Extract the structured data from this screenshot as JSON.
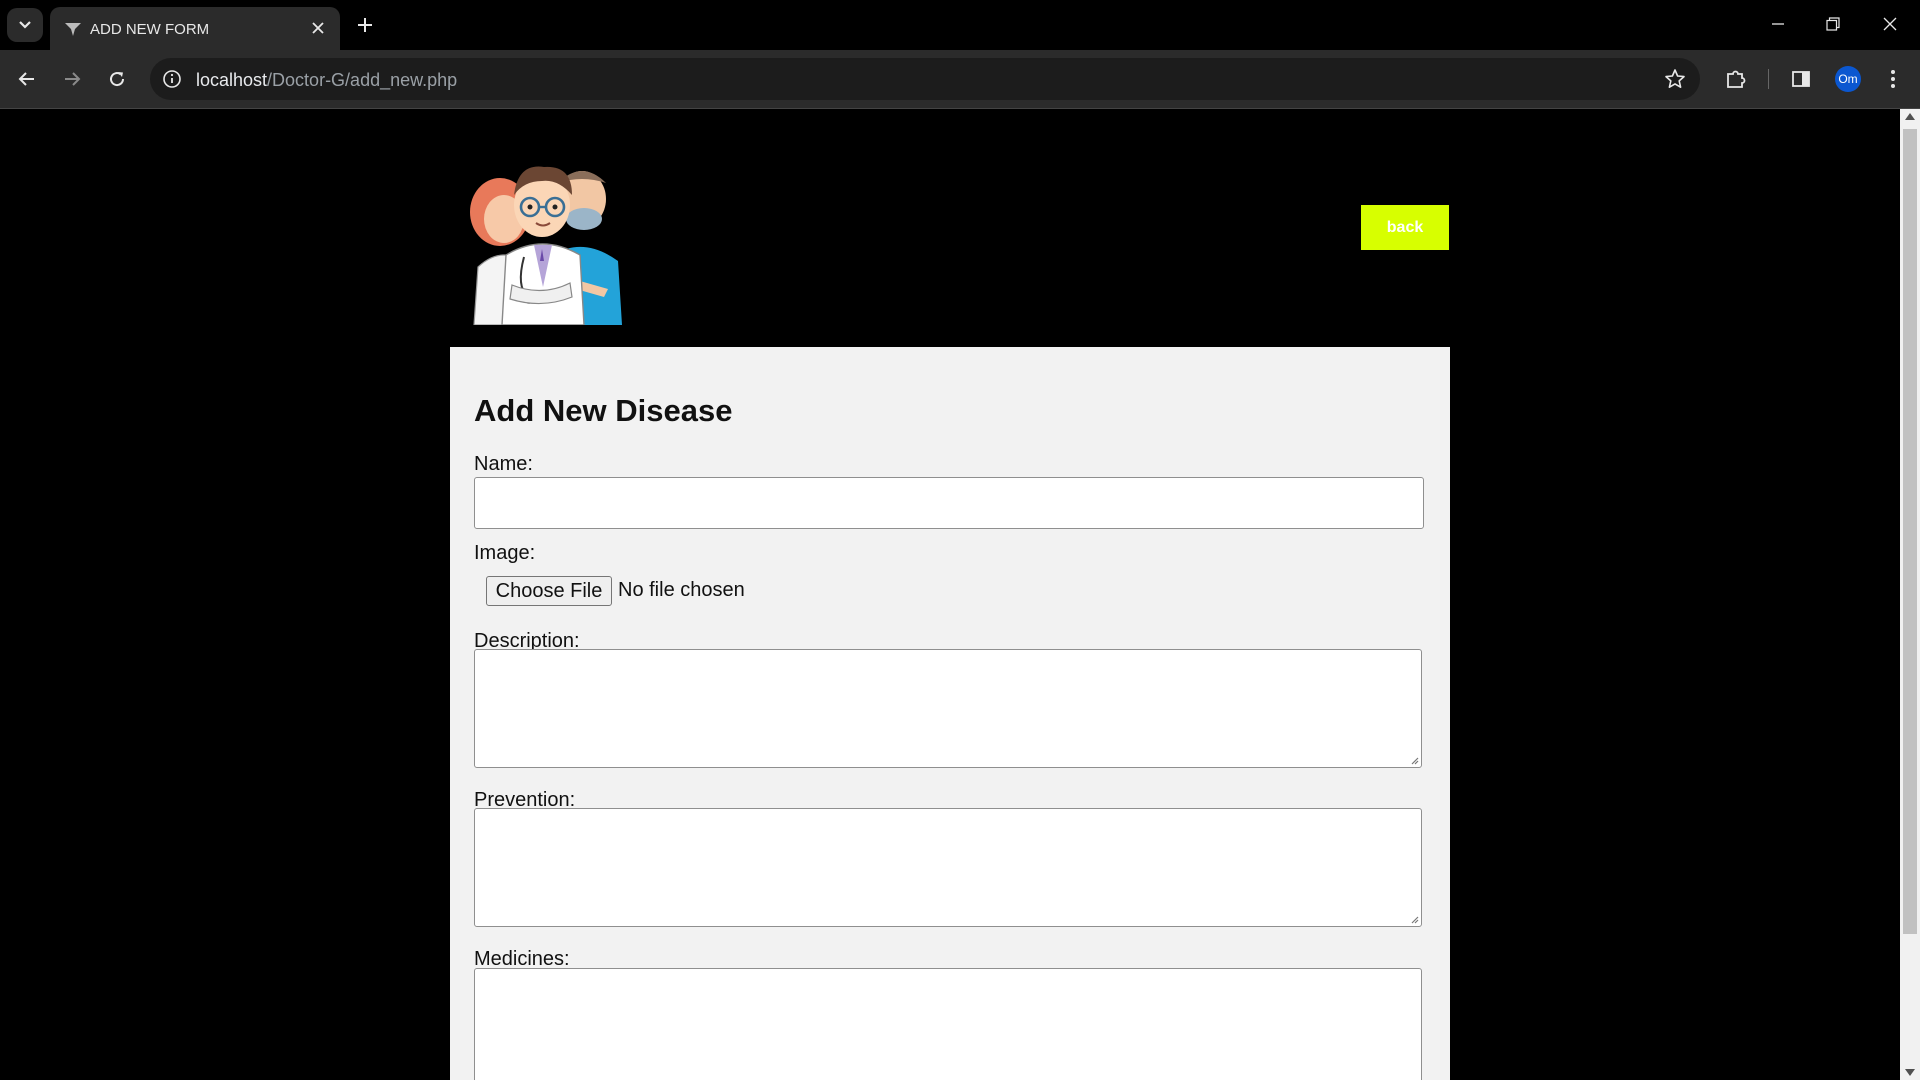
{
  "browser": {
    "tab_title": "ADD NEW FORM",
    "url_host": "localhost",
    "url_path": "/Doctor-G/add_new.php",
    "profile_initials": "Om"
  },
  "header": {
    "logo_icon": "doctors-illustration",
    "back_label": "back",
    "back_color": "#d7ff00"
  },
  "form": {
    "title": "Add New Disease",
    "name_label": "Name:",
    "name_value": "",
    "image_label": "Image:",
    "choose_file_label": "Choose File",
    "file_status": "No file chosen",
    "description_label": "Description:",
    "prevention_label": "Prevention:",
    "medicines_label": "Medicines:"
  }
}
